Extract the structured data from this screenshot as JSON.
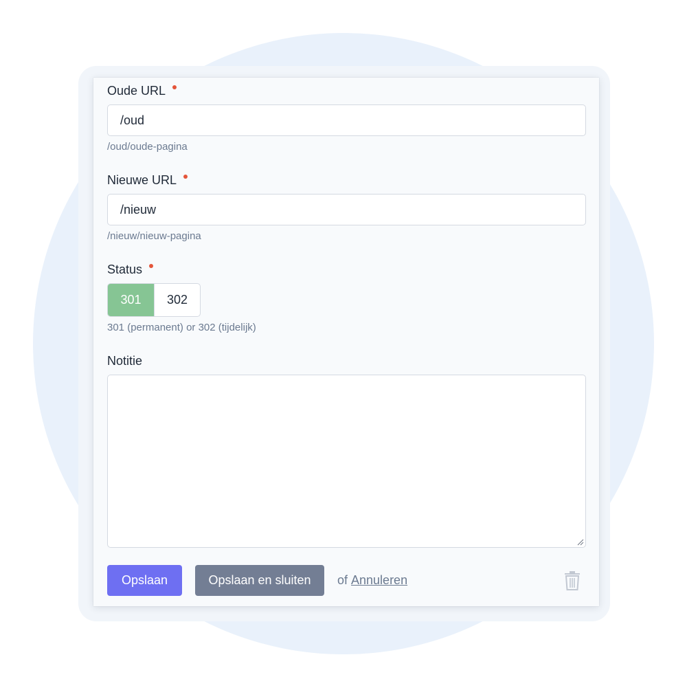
{
  "form": {
    "old_url": {
      "label": "Oude URL",
      "value": "/oud",
      "hint": "/oud/oude-pagina",
      "required": true
    },
    "new_url": {
      "label": "Nieuwe URL",
      "value": "/nieuw",
      "hint": "/nieuw/nieuw-pagina",
      "required": true
    },
    "status": {
      "label": "Status",
      "options": [
        "301",
        "302"
      ],
      "selected": "301",
      "hint": "301 (permanent) or 302 (tijdelijk)",
      "required": true
    },
    "note": {
      "label": "Notitie",
      "value": ""
    }
  },
  "actions": {
    "save_label": "Opslaan",
    "save_close_label": "Opslaan en sluiten",
    "or_label": "of",
    "cancel_label": "Annuleren",
    "delete_icon": "trash-icon"
  },
  "colors": {
    "primary": "#6e6ff2",
    "secondary": "#737e94",
    "active_status": "#86c594",
    "required_dot": "#e4553a",
    "background_circle": "#e9f1fb"
  }
}
